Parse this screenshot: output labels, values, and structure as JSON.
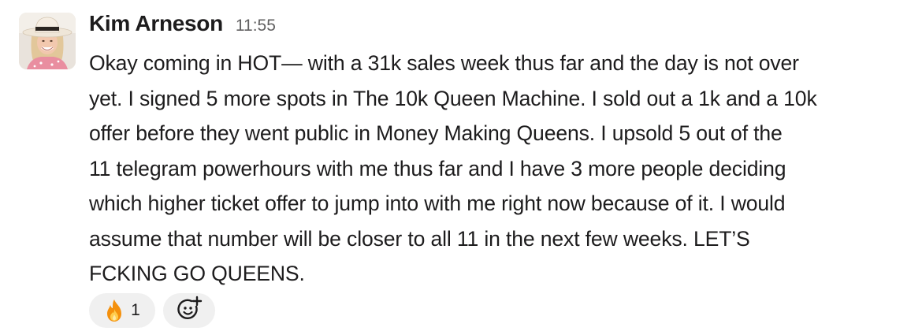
{
  "message": {
    "author": "Kim Arneson",
    "time": "11:55",
    "avatar_icon": "user-avatar",
    "lines": [
      "Okay coming in HOT— with a 31k sales week thus far and the day is not over",
      "yet. I signed 5 more spots in The 10k Queen Machine. I sold out a 1k and a 10k",
      "offer before they went public in Money Making Queens. I upsold 5 out of the",
      "11 telegram powerhours with me thus far and I have 3 more people deciding",
      "which higher ticket offer to jump into with me right now because of it. I would",
      "assume that number will be closer to all 11 in the next few weeks. LET’S",
      "FCKING GO QUEENS."
    ]
  },
  "reactions": [
    {
      "emoji": "fire-icon",
      "count": "1"
    }
  ],
  "add_reaction_icon": "add-reaction-icon",
  "colors": {
    "text": "#1d1c1d",
    "muted": "#616061",
    "pill": "#f0f0f0"
  }
}
